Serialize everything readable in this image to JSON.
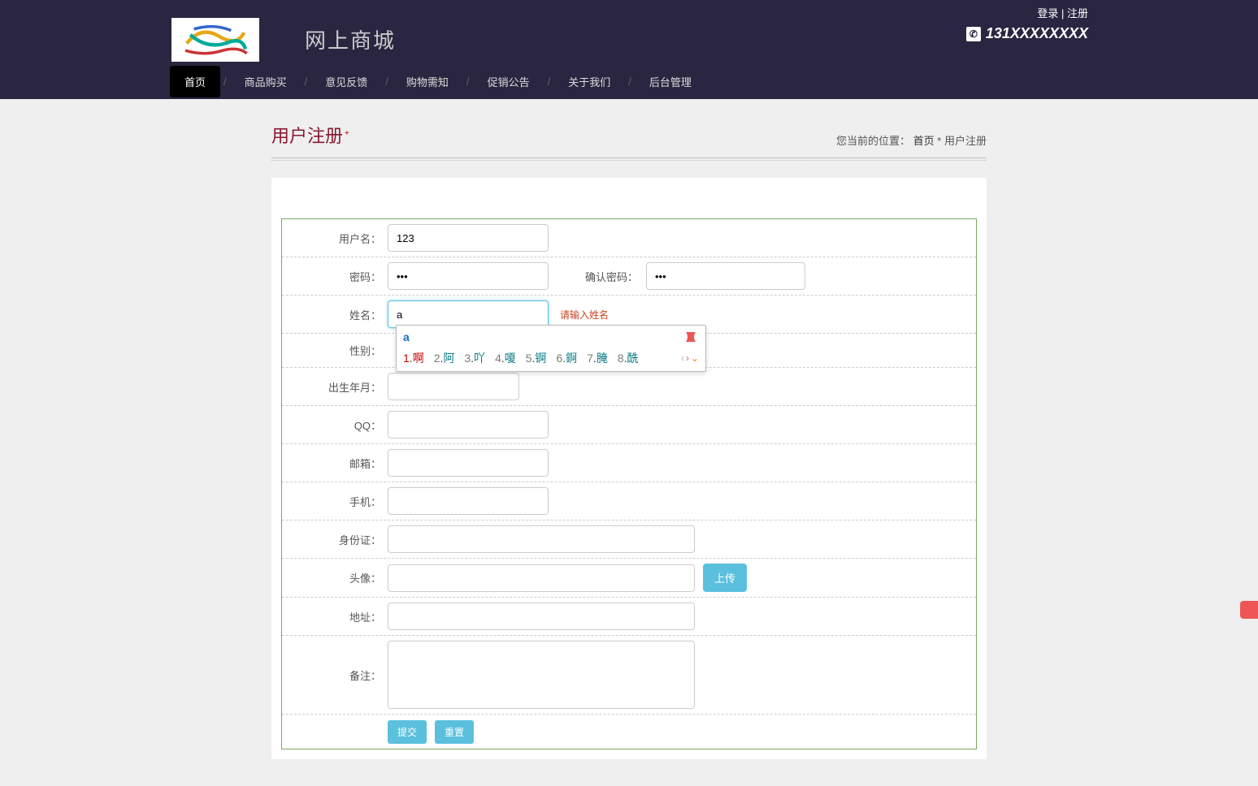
{
  "header": {
    "site_title": "网上商城",
    "login": "登录",
    "register": "注册",
    "phone": "131XXXXXXXX"
  },
  "nav": {
    "items": [
      "首页",
      "商品购买",
      "意见反馈",
      "购物需知",
      "促销公告",
      "关于我们",
      "后台管理"
    ],
    "active_index": 0
  },
  "page": {
    "title": "用户注册",
    "breadcrumb_prefix": "您当前的位置：",
    "breadcrumb_home": "首页",
    "breadcrumb_sep": "*",
    "breadcrumb_current": "用户注册"
  },
  "form": {
    "labels": {
      "username": "用户名：",
      "password": "密码：",
      "password_confirm": "确认密码：",
      "realname": "姓名：",
      "gender": "性别：",
      "birthday": "出生年月：",
      "qq": "QQ：",
      "email": "邮箱：",
      "mobile": "手机：",
      "idcard": "身份证：",
      "avatar": "头像：",
      "address": "地址：",
      "remark": "备注："
    },
    "values": {
      "username": "123",
      "password": "•••",
      "password_confirm": "•••",
      "realname": "a",
      "gender": "",
      "birthday": "",
      "qq": "",
      "email": "",
      "mobile": "",
      "idcard": "",
      "avatar": "",
      "address": "",
      "remark": ""
    },
    "errors": {
      "realname": "请输入姓名"
    },
    "buttons": {
      "upload": "上传",
      "submit": "提交",
      "reset": "重置"
    }
  },
  "ime": {
    "input": "a",
    "candidates": [
      {
        "n": "1",
        "ch": "啊"
      },
      {
        "n": "2",
        "ch": "阿"
      },
      {
        "n": "3",
        "ch": "吖"
      },
      {
        "n": "4",
        "ch": "嗄"
      },
      {
        "n": "5",
        "ch": "锕"
      },
      {
        "n": "6",
        "ch": "錒"
      },
      {
        "n": "7",
        "ch": "腌"
      },
      {
        "n": "8",
        "ch": "酰"
      }
    ]
  }
}
